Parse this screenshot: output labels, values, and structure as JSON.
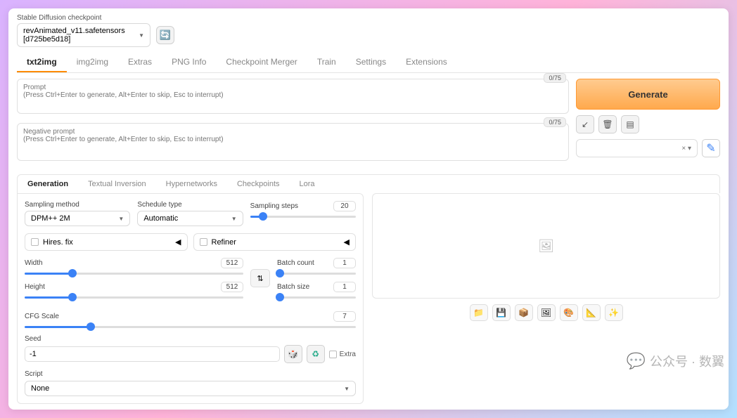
{
  "checkpoint": {
    "label": "Stable Diffusion checkpoint",
    "value": "revAnimated_v11.safetensors [d725be5d18]"
  },
  "mainTabs": [
    "txt2img",
    "img2img",
    "Extras",
    "PNG Info",
    "Checkpoint Merger",
    "Train",
    "Settings",
    "Extensions"
  ],
  "prompt": {
    "label": "Prompt",
    "hint": "(Press Ctrl+Enter to generate, Alt+Enter to skip, Esc to interrupt)",
    "counter": "0/75"
  },
  "neg": {
    "label": "Negative prompt",
    "hint": "(Press Ctrl+Enter to generate, Alt+Enter to skip, Esc to interrupt)",
    "counter": "0/75"
  },
  "generate": "Generate",
  "styleDropdown": "× ▾",
  "subTabs": [
    "Generation",
    "Textual Inversion",
    "Hypernetworks",
    "Checkpoints",
    "Lora"
  ],
  "sampling": {
    "methodLabel": "Sampling method",
    "method": "DPM++ 2M",
    "scheduleLabel": "Schedule type",
    "schedule": "Automatic",
    "stepsLabel": "Sampling steps",
    "steps": "20"
  },
  "hires": "Hires. fix",
  "refiner": "Refiner",
  "dims": {
    "widthLabel": "Width",
    "width": "512",
    "heightLabel": "Height",
    "height": "512"
  },
  "batch": {
    "countLabel": "Batch count",
    "count": "1",
    "sizeLabel": "Batch size",
    "size": "1"
  },
  "cfg": {
    "label": "CFG Scale",
    "value": "7"
  },
  "seed": {
    "label": "Seed",
    "value": "-1",
    "extra": "Extra"
  },
  "script": {
    "label": "Script",
    "value": "None"
  },
  "watermark": "公众号 · 数翼"
}
